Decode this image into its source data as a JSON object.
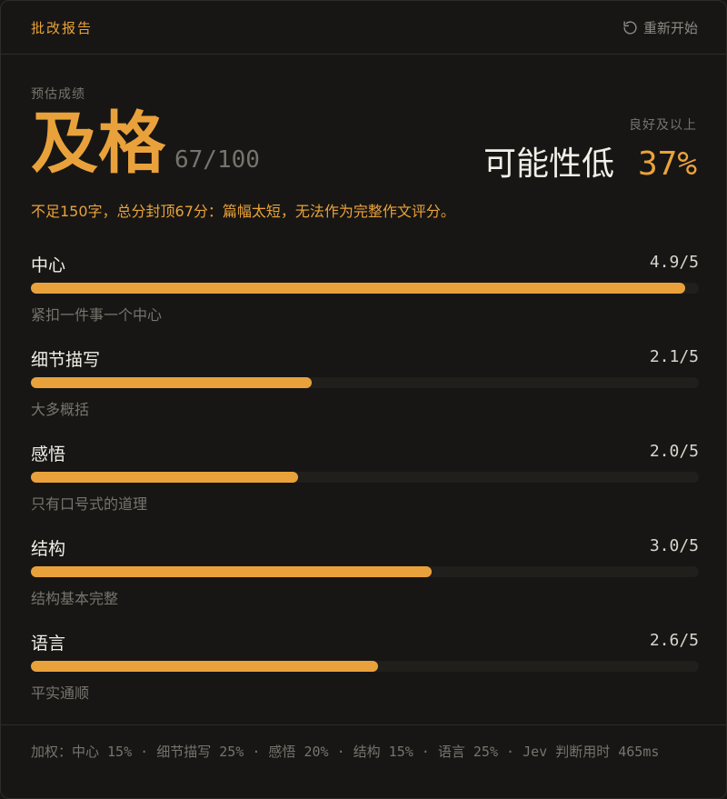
{
  "header": {
    "title": "批改报告",
    "restart_label": "重新开始",
    "restart_icon": "rotate-ccw-icon"
  },
  "summary": {
    "estimate_label": "预估成绩",
    "grade": "及格",
    "score": "67/100",
    "probability_caption": "良好及以上",
    "probability_text": "可能性低",
    "probability_percent": "37%",
    "note": "不足150字，总分封顶67分：篇幅太短，无法作为完整作文评分。"
  },
  "criteria": [
    {
      "name": "中心",
      "score": "4.9/5",
      "value": 4.9,
      "max": 5,
      "desc": "紧扣一件事一个中心"
    },
    {
      "name": "细节描写",
      "score": "2.1/5",
      "value": 2.1,
      "max": 5,
      "desc": "大多概括"
    },
    {
      "name": "感悟",
      "score": "2.0/5",
      "value": 2.0,
      "max": 5,
      "desc": "只有口号式的道理"
    },
    {
      "name": "结构",
      "score": "3.0/5",
      "value": 3.0,
      "max": 5,
      "desc": "结构基本完整"
    },
    {
      "name": "语言",
      "score": "2.6/5",
      "value": 2.6,
      "max": 5,
      "desc": "平实通顺"
    }
  ],
  "footer": {
    "text": "加权：中心 15% · 细节描写 25% · 感悟 20% · 结构 15% · 语言 25% · Jev 判断用时 465ms"
  },
  "colors": {
    "accent": "#e9a23b",
    "background": "#171614",
    "muted": "#77746e"
  }
}
